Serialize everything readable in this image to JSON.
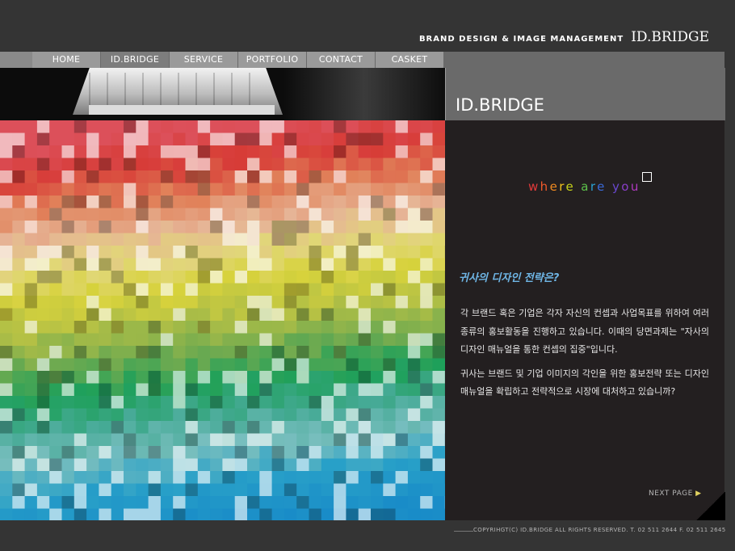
{
  "header": {
    "tagline": "BRAND DESIGN & IMAGE MANAGEMENT",
    "logo": "ID.BRIDGE"
  },
  "nav": {
    "items": [
      {
        "label": "HOME"
      },
      {
        "label": "ID.BRIDGE"
      },
      {
        "label": "SERVICE"
      },
      {
        "label": "PORTFOLIO"
      },
      {
        "label": "CONTACT"
      },
      {
        "label": "CASKET"
      }
    ],
    "active": "ID.BRIDGE"
  },
  "panel": {
    "title": "ID.BRIDGE",
    "slogan": "where are you",
    "slogan_colors": [
      "#e23a3a",
      "#f05a2a",
      "#f08a20",
      "#f2c21a",
      "#c6d21a",
      "#5cc04a",
      "#2aa0d0",
      "#3a6ad8",
      "#6a48d0",
      "#8a3ec8",
      "#b03ac0",
      "#c03a9a",
      "#c0409a"
    ],
    "headline": "귀사의 디자인 전략은?",
    "paragraphs": [
      "각 브랜드 혹은 기업은 각자 자신의 컨셉과 사업목표를 위하여 여러 종류의 홍보활동을 진행하고 있습니다. 이때의 당면과제는 \"자사의 디자인 매뉴얼을 통한 컨셉의 집중\"입니다.",
      "귀사는 브랜드 및 기업 이미지의 각인을 위한 홍보전략 또는 디자인 매뉴얼을 확립하고 전략적으로 시장에 대처하고 있습니까?"
    ],
    "next_label": "NEXT PAGE"
  },
  "footer": {
    "copyright": "COPYRIHGT(C) ID.BRIDGE ALL RIGHTS RESERVED. T. 02 511 2644 F. 02 511 2645"
  },
  "colors": {
    "background": "#343434",
    "panel": "#231f20",
    "nav_item": "#9a9a9a",
    "headline": "#6fb6e6"
  }
}
